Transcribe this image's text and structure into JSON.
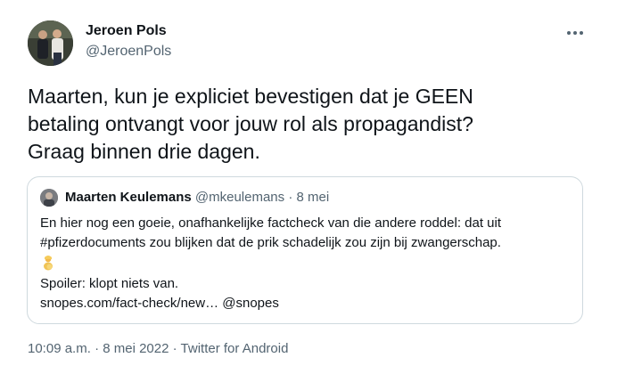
{
  "author": {
    "name": "Jeroen Pols",
    "handle": "@JeroenPols"
  },
  "tweet": {
    "text_lines": [
      "Maarten, kun je expliciet bevestigen dat je GEEN",
      "betaling ontvangt voor jouw rol als propagandist?",
      "Graag binnen drie dagen."
    ]
  },
  "quoted_tweet": {
    "author_name": "Maarten Keulemans",
    "author_handle": "@mkeulemans",
    "separator": "·",
    "date": "8 mei",
    "body_lines": [
      "En hier nog een goeie, onafhankelijke factcheck van die andere roddel: dat uit",
      "#pfizerdocuments zou blijken dat de prik schadelijk zou zijn bij zwangerschap."
    ],
    "emoji": "pregnant-emoji",
    "spoiler_line": "Spoiler: klopt niets van.",
    "link_text": "snopes.com/fact-check/new…",
    "mention": "@snopes"
  },
  "meta": {
    "time": "10:09 a.m.",
    "separator": "·",
    "date": "8 mei 2022",
    "source": "Twitter for Android"
  },
  "colors": {
    "text": "#0f1419",
    "secondary": "#536471",
    "border": "#cfd9de"
  }
}
